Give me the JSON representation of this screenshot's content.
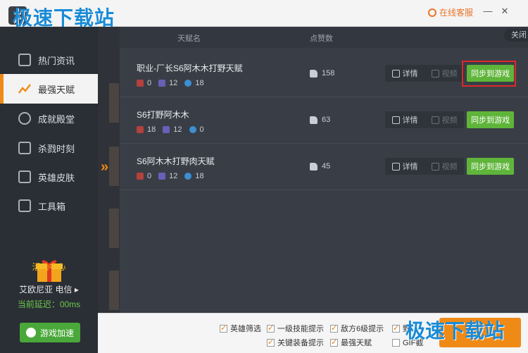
{
  "watermark": "极速下载站",
  "titlebar": {
    "service": "在线客服",
    "minimize": "—",
    "close": "✕"
  },
  "sidebar": {
    "items": [
      {
        "label": "热门资讯",
        "icon": "news-icon"
      },
      {
        "label": "最强天赋",
        "icon": "trend-icon",
        "active": true
      },
      {
        "label": "成就殿堂",
        "icon": "medal-icon"
      },
      {
        "label": "杀戮时刻",
        "icon": "gif-icon"
      },
      {
        "label": "英雄皮肤",
        "icon": "shirt-icon"
      },
      {
        "label": "工具箱",
        "icon": "toolbox-icon"
      }
    ],
    "activity": "活动中心",
    "server": "艾欧尼亚 电信",
    "delay": "当前延迟：00ms",
    "accelerate": "游戏加速"
  },
  "panel": {
    "header": {
      "name": "天赋名",
      "likes": "点赞数",
      "close": "关闭"
    },
    "rows": [
      {
        "title": "职业-厂长S6阿木木打野天赋",
        "a": "0",
        "b": "12",
        "c": "18",
        "likes": "158",
        "detail": "详情",
        "video": "视频",
        "sync": "同步到游戏"
      },
      {
        "title": "S6打野阿木木",
        "a": "18",
        "b": "12",
        "c": "0",
        "likes": "63",
        "detail": "详情",
        "video": "视频",
        "sync": "同步到游戏"
      },
      {
        "title": "S6阿木木打野肉天赋",
        "a": "0",
        "b": "12",
        "c": "18",
        "likes": "45",
        "detail": "详情",
        "video": "视频",
        "sync": "同步到游戏"
      }
    ]
  },
  "options": [
    {
      "label": "英雄筛选",
      "checked": true
    },
    {
      "label": "一级技能提示",
      "checked": true
    },
    {
      "label": "敌方6级提示",
      "checked": true
    },
    {
      "label": "野",
      "checked": true
    },
    {
      "label": "关键装备提示",
      "checked": true
    },
    {
      "label": "最强天赋",
      "checked": true
    },
    {
      "label": "GIF截",
      "checked": false
    }
  ],
  "colors": {
    "accent": "#f08a16",
    "green": "#5fb53a",
    "highlight": "#e0272a"
  }
}
